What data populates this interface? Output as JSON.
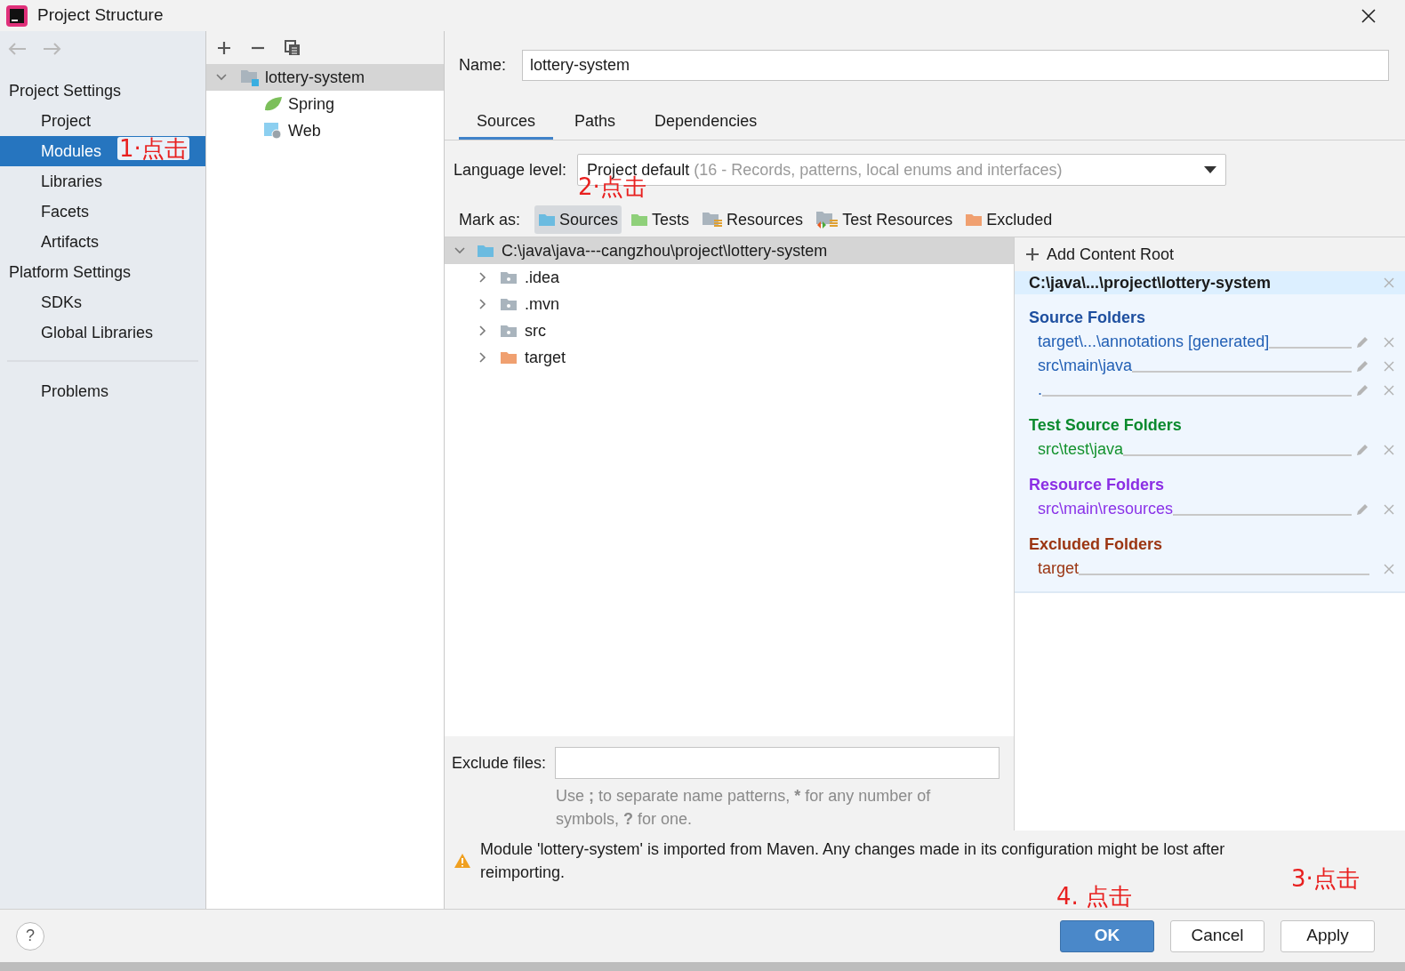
{
  "window": {
    "title": "Project Structure"
  },
  "sidebar": {
    "sections": [
      {
        "title": "Project Settings",
        "items": [
          {
            "label": "Project",
            "selected": false
          },
          {
            "label": "Modules",
            "selected": true
          },
          {
            "label": "Libraries",
            "selected": false
          },
          {
            "label": "Facets",
            "selected": false
          },
          {
            "label": "Artifacts",
            "selected": false
          }
        ]
      },
      {
        "title": "Platform Settings",
        "items": [
          {
            "label": "SDKs",
            "selected": false
          },
          {
            "label": "Global Libraries",
            "selected": false
          }
        ]
      }
    ],
    "bottom_items": [
      {
        "label": "Problems",
        "selected": false
      }
    ]
  },
  "modules_tree": [
    {
      "label": "lottery-system",
      "selected": true,
      "expanded": true,
      "children": [
        {
          "label": "Spring",
          "kind": "spring",
          "selected": false
        },
        {
          "label": "Web",
          "kind": "web",
          "selected": false
        }
      ]
    }
  ],
  "name_field": {
    "label": "Name:",
    "value": "lottery-system"
  },
  "tabs": [
    {
      "label": "Sources",
      "selected": true
    },
    {
      "label": "Paths",
      "selected": false
    },
    {
      "label": "Dependencies",
      "selected": false
    }
  ],
  "language_level": {
    "label": "Language level:",
    "value": "Project default",
    "hint": "(16 - Records, patterns, local enums and interfaces)"
  },
  "mark_as": {
    "label": "Mark as:",
    "buttons": [
      {
        "label": "Sources",
        "kind": "sources",
        "selected": true
      },
      {
        "label": "Tests",
        "kind": "tests",
        "selected": false
      },
      {
        "label": "Resources",
        "kind": "resources",
        "selected": false
      },
      {
        "label": "Test Resources",
        "kind": "test_resources",
        "selected": false
      },
      {
        "label": "Excluded",
        "kind": "excluded",
        "selected": false
      }
    ]
  },
  "folder_tree": {
    "label": "C:\\java\\java---cangzhou\\project\\lottery-system",
    "expanded": true,
    "children": [
      {
        "label": ".idea",
        "kind": "folder",
        "expanded": false
      },
      {
        "label": ".mvn",
        "kind": "folder",
        "expanded": false
      },
      {
        "label": "src",
        "kind": "folder",
        "expanded": false
      },
      {
        "label": "target",
        "kind": "excluded",
        "expanded": false
      }
    ]
  },
  "content_root": {
    "add_label": "Add Content Root",
    "path": "C:\\java\\...\\project\\lottery-system",
    "groups": [
      {
        "title": "Source Folders",
        "kind": "source",
        "entries": [
          {
            "path": "target\\...\\annotations [generated]",
            "editable": true
          },
          {
            "path": "src\\main\\java",
            "editable": true
          },
          {
            "path": ".",
            "editable": true
          }
        ]
      },
      {
        "title": "Test Source Folders",
        "kind": "test",
        "entries": [
          {
            "path": "src\\test\\java",
            "editable": true
          }
        ]
      },
      {
        "title": "Resource Folders",
        "kind": "resource",
        "entries": [
          {
            "path": "src\\main\\resources",
            "editable": true
          }
        ]
      },
      {
        "title": "Excluded Folders",
        "kind": "excluded",
        "entries": [
          {
            "path": "target",
            "editable": false
          }
        ]
      }
    ]
  },
  "exclude_files": {
    "label": "Exclude files:",
    "hint": "Use **;** to separate name patterns, ***** for any number of symbols, **?** for one."
  },
  "warning": "Module 'lottery-system' is imported from Maven. Any changes made in its configuration might be lost after reimporting.",
  "help_button": {
    "label": "?"
  },
  "buttons": [
    {
      "label": "OK",
      "kind": "default"
    },
    {
      "label": "Cancel",
      "kind": "normal"
    },
    {
      "label": "Apply",
      "kind": "normal"
    }
  ],
  "annotations": [
    {
      "text": "1·点击"
    },
    {
      "text": "2·点击"
    },
    {
      "text": "3·点击"
    },
    {
      "text": "4. 点击"
    }
  ]
}
